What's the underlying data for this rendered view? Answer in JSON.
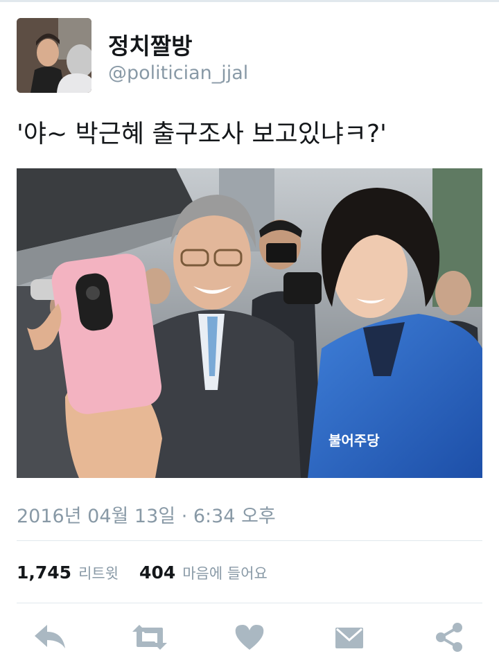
{
  "tweet": {
    "display_name": "정치짤방",
    "handle": "@politician_jjal",
    "text": "'야~ 박근혜 출구조사 보고있냐ㅋ?'",
    "timestamp": "2016년 04월 13일 · 6:34 오후"
  },
  "stats": {
    "retweets_count": "1,745",
    "retweets_label": "리트윗",
    "likes_count": "404",
    "likes_label": "마음에 들어요"
  },
  "photo": {
    "jacket_text": "불어주당"
  },
  "actions": [
    {
      "name": "reply",
      "icon": "reply-icon"
    },
    {
      "name": "retweet",
      "icon": "retweet-icon"
    },
    {
      "name": "like",
      "icon": "heart-icon"
    },
    {
      "name": "message",
      "icon": "envelope-icon"
    },
    {
      "name": "share",
      "icon": "share-icon"
    }
  ],
  "colors": {
    "text": "#14171a",
    "muted": "#8899a6",
    "icon": "#aab8c2",
    "divider": "#e1e8ed"
  }
}
